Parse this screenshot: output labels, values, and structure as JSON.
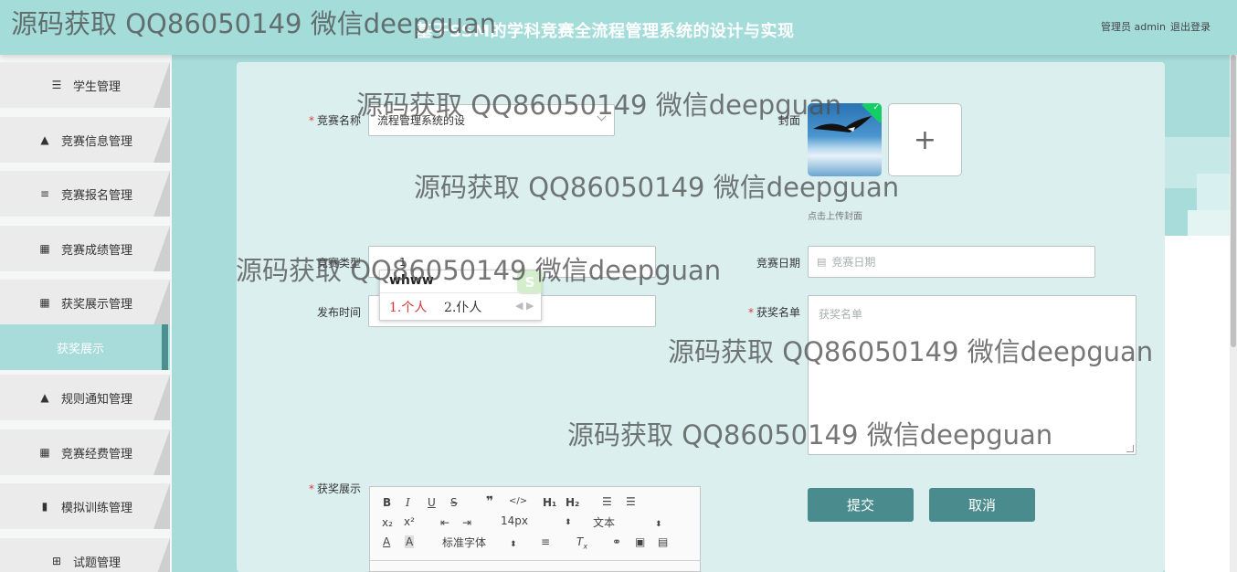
{
  "header": {
    "title": "基于SSM的学科竞赛全流程管理系统的设计与实现",
    "admin": "管理员 admin",
    "logout": "退出登录"
  },
  "sidebar": {
    "items": [
      {
        "label": "学生管理",
        "icon": "sliders-icon"
      },
      {
        "label": "竞赛信息管理",
        "icon": "person-icon"
      },
      {
        "label": "竞赛报名管理",
        "icon": "list-icon"
      },
      {
        "label": "竞赛成绩管理",
        "icon": "grid-icon"
      },
      {
        "label": "获奖展示管理",
        "icon": "grid-icon"
      },
      {
        "label": "获奖展示",
        "active": true
      },
      {
        "label": "规则通知管理",
        "icon": "person-icon"
      },
      {
        "label": "竞赛经费管理",
        "icon": "grid-icon"
      },
      {
        "label": "模拟训练管理",
        "icon": "bar-chart-icon"
      },
      {
        "label": "试题管理",
        "icon": "apps-icon"
      }
    ]
  },
  "form": {
    "competition_name": {
      "label": "竞赛名称",
      "value": "流程管理系统的设"
    },
    "cover": {
      "label": "封面",
      "hint": "点击上传封面"
    },
    "competition_type": {
      "label": "竞赛类型",
      "value": "1"
    },
    "competition_date": {
      "label": "竞赛日期",
      "placeholder": "竞赛日期"
    },
    "publish_time": {
      "label": "发布时间"
    },
    "winner_list": {
      "label": "获奖名单",
      "placeholder": "获奖名单"
    },
    "award_display": {
      "label": "获奖展示"
    }
  },
  "ime": {
    "typed": "whww",
    "candidate1": "1.个人",
    "candidate2": "2.仆人"
  },
  "editor": {
    "font_size": "14px",
    "header": "文本",
    "font_family": "标准字体"
  },
  "buttons": {
    "submit": "提交",
    "cancel": "取消"
  },
  "watermark": "源码获取 QQ86050149 微信deepguan"
}
